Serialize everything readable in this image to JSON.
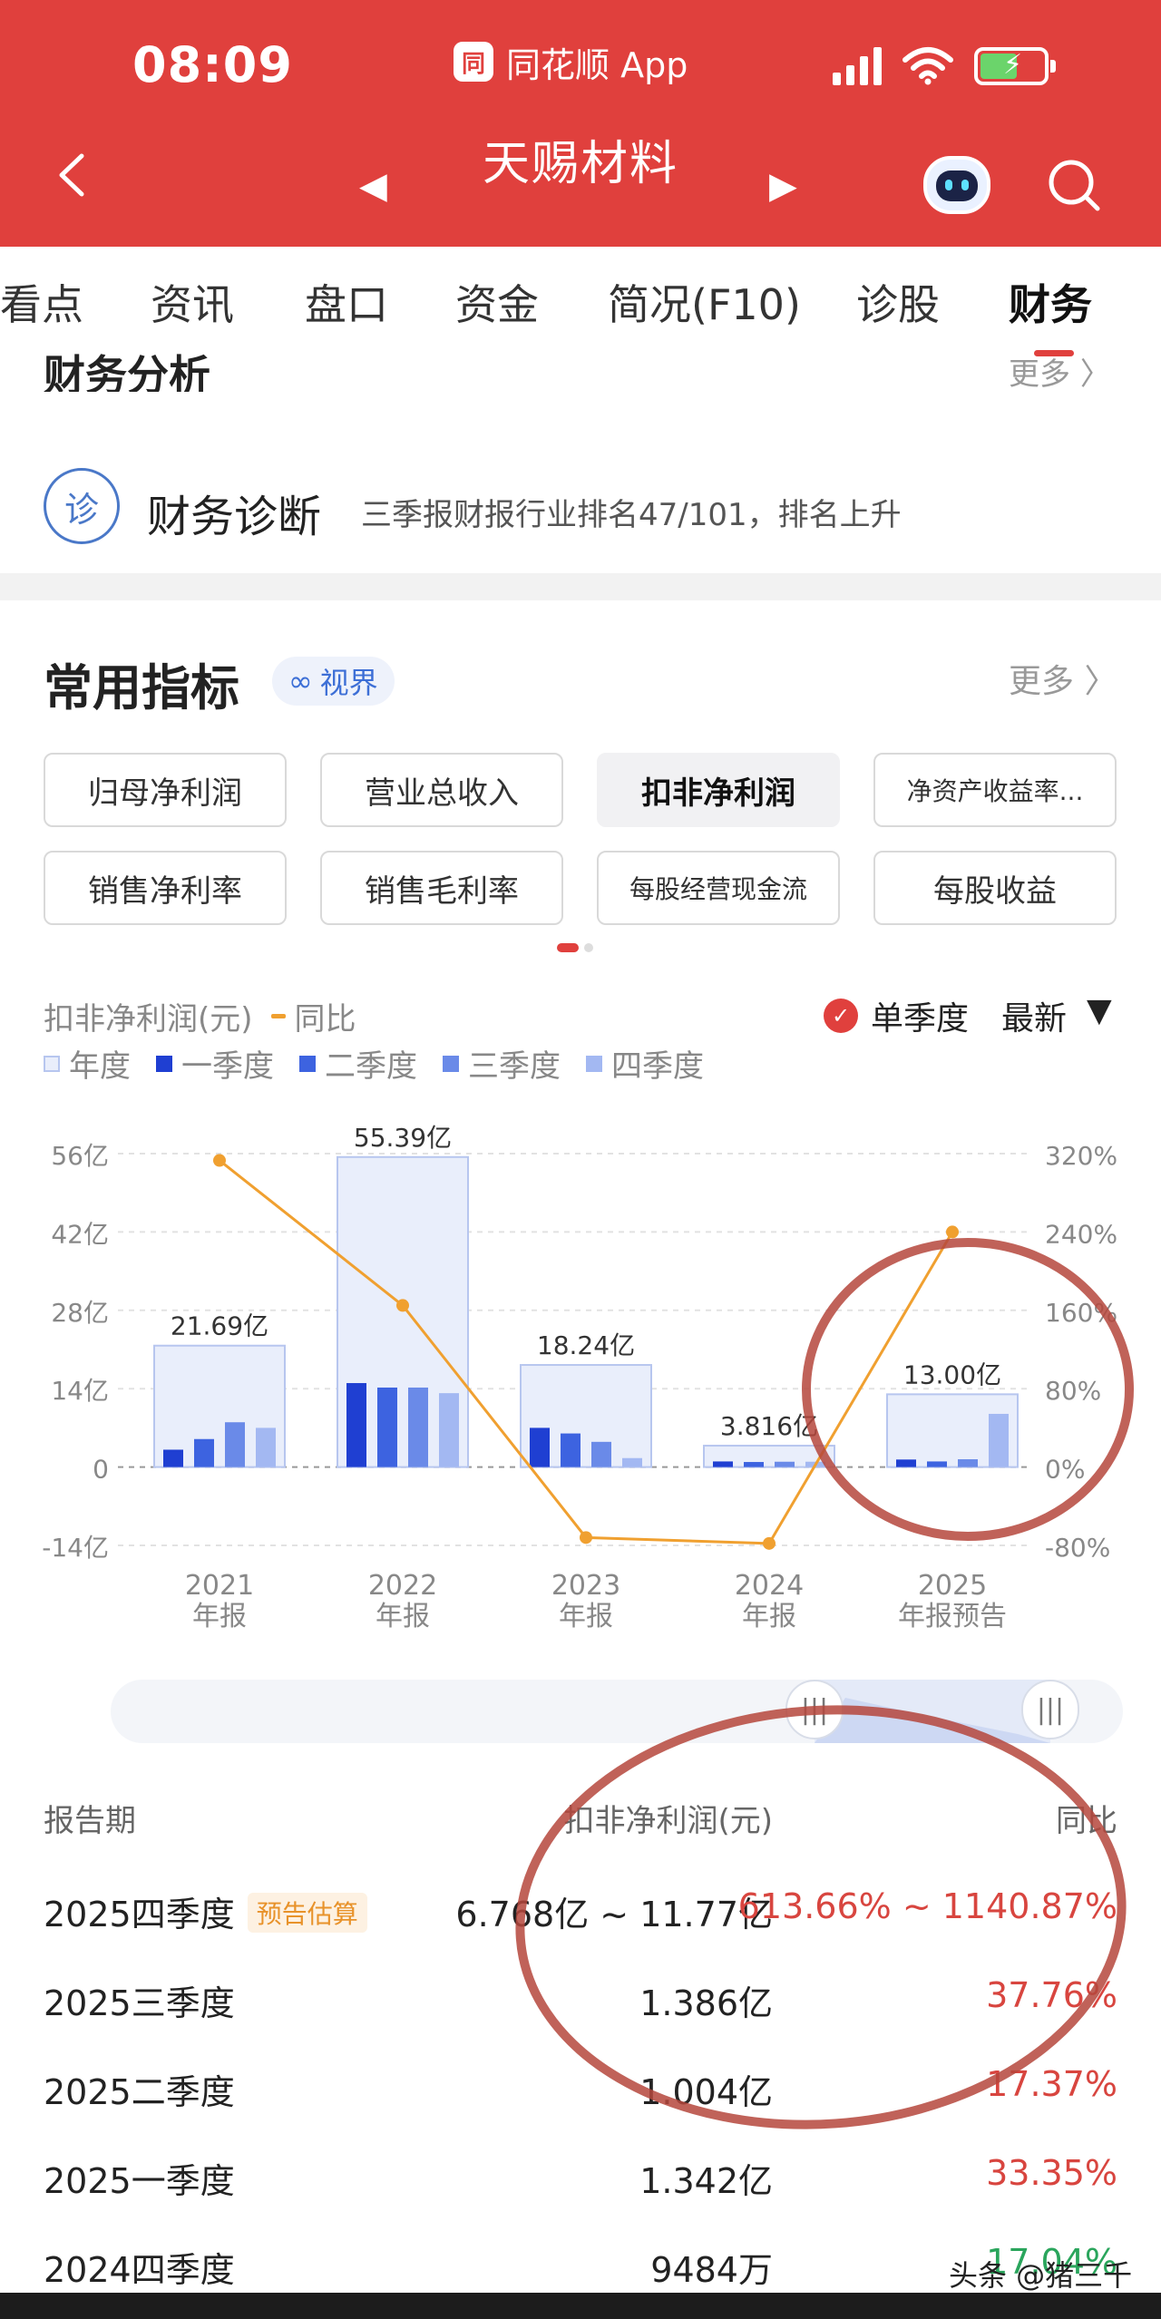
{
  "status": {
    "time": "08:09",
    "app_name": "同花顺 App",
    "app_logo_glyph": "同"
  },
  "header": {
    "title": "天赐材料"
  },
  "tabs": [
    "看点",
    "资讯",
    "盘口",
    "资金",
    "简况(F10)",
    "诊股",
    "财务"
  ],
  "finance_analysis": {
    "title": "财务分析",
    "more": "更多"
  },
  "diagnosis": {
    "icon_text": "诊",
    "title": "财务诊断",
    "text": "三季报财报行业排名47/101，排名上升"
  },
  "indicators": {
    "title": "常用指标",
    "badge": "视界",
    "more": "更多",
    "buttons": [
      "归母净利润",
      "营业总收入",
      "扣非净利润",
      "净资产收益率...",
      "销售净利率",
      "销售毛利率",
      "每股经营现金流",
      "每股收益"
    ],
    "active_index": 2
  },
  "chart_controls": {
    "metric_label": "扣非净利润(元)",
    "yoy_label": "同比",
    "single_quarter": "单季度",
    "latest": "最新"
  },
  "legend": [
    "年度",
    "一季度",
    "二季度",
    "三季度",
    "四季度"
  ],
  "colors": {
    "brand_red": "#e0403d",
    "annual_fill": "#e9eefb",
    "annual_stroke": "#b7c6ef",
    "q1": "#1f3fd2",
    "q2": "#3d63e0",
    "q3": "#6a8ae8",
    "q4": "#a3b8f2",
    "yoy_line": "#f0a030",
    "positive": "#d8453f",
    "negative": "#2aa55c",
    "annotation_circle": "#b5473c"
  },
  "chart_data": {
    "type": "bar",
    "categories": [
      "2021\n年报",
      "2022\n年报",
      "2023\n年报",
      "2024\n年报",
      "2025\n年报预告"
    ],
    "category_lines": [
      [
        "2021",
        "年报"
      ],
      [
        "2022",
        "年报"
      ],
      [
        "2023",
        "年报"
      ],
      [
        "2024",
        "年报"
      ],
      [
        "2025",
        "年报预告"
      ]
    ],
    "annual_values": [
      21.69,
      55.39,
      18.24,
      3.816,
      13.0
    ],
    "annual_labels": [
      "21.69亿",
      "55.39亿",
      "18.24亿",
      "3.816亿",
      "13.00亿"
    ],
    "series": [
      {
        "name": "一季度",
        "values": [
          3.1,
          15.0,
          7.0,
          1.0,
          1.34
        ]
      },
      {
        "name": "二季度",
        "values": [
          5.0,
          14.2,
          6.0,
          0.9,
          1.0
        ]
      },
      {
        "name": "三季度",
        "values": [
          8.0,
          14.2,
          4.5,
          0.95,
          1.39
        ]
      },
      {
        "name": "四季度",
        "values": [
          7.0,
          13.2,
          1.6,
          0.95,
          9.5
        ]
      }
    ],
    "yoy": [
      313,
      165,
      -72,
      -78,
      240
    ],
    "ylim": [
      -14,
      56
    ],
    "yticks": [
      "-14亿",
      "0",
      "14亿",
      "28亿",
      "42亿",
      "56亿"
    ],
    "ytick_values": [
      -14,
      0,
      14,
      28,
      42,
      56
    ],
    "y2lim": [
      -80,
      320
    ],
    "y2ticks": [
      "-80%",
      "0%",
      "80%",
      "160%",
      "240%",
      "320%"
    ],
    "y2tick_values": [
      -80,
      0,
      80,
      160,
      240,
      320
    ]
  },
  "table": {
    "headers": [
      "报告期",
      "扣非净利润(元)",
      "同比"
    ],
    "rows": [
      {
        "period": "2025四季度",
        "badge": "预告估算",
        "value": "6.768亿 ~ 11.77亿",
        "yoy": "613.66% ~ 1140.87%",
        "trend": "up"
      },
      {
        "period": "2025三季度",
        "badge": "",
        "value": "1.386亿",
        "yoy": "37.76%",
        "trend": "up"
      },
      {
        "period": "2025二季度",
        "badge": "",
        "value": "1.004亿",
        "yoy": "17.37%",
        "trend": "up"
      },
      {
        "period": "2025一季度",
        "badge": "",
        "value": "1.342亿",
        "yoy": "33.35%",
        "trend": "up"
      },
      {
        "period": "2024四季度",
        "badge": "",
        "value": "9484万",
        "yoy": "17.04%",
        "trend": "down"
      }
    ]
  },
  "watermark": "头条 @猪三千"
}
